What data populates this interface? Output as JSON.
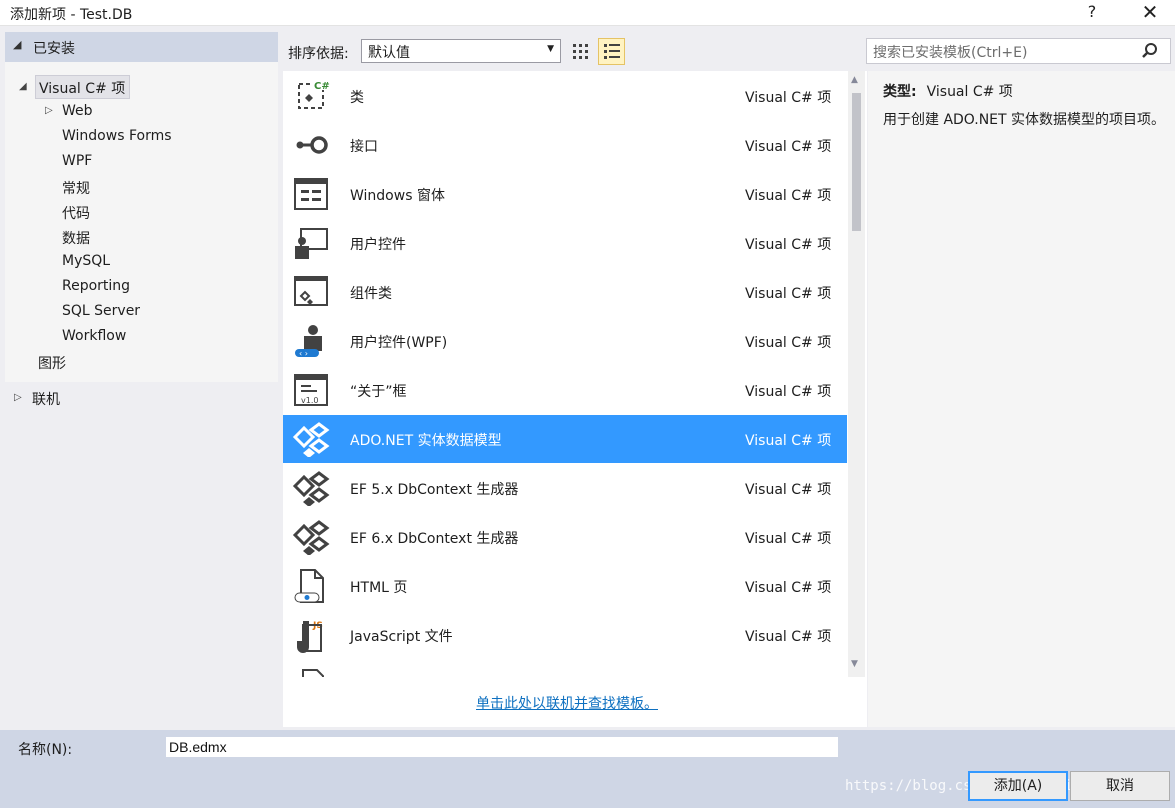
{
  "window": {
    "title": "添加新项 - Test.DB",
    "help": "?",
    "close": "✕"
  },
  "left": {
    "installed_label": "已安装",
    "root_label": "Visual C# 项",
    "children": [
      "Web",
      "Windows Forms",
      "WPF",
      "常规",
      "代码",
      "数据",
      "MySQL",
      "Reporting",
      "SQL Server",
      "Workflow"
    ],
    "graphics_label": "图形",
    "online_label": "联机"
  },
  "toolbar": {
    "sort_label": "排序依据:",
    "sort_value": "默认值",
    "search_placeholder": "搜索已安装模板(Ctrl+E)"
  },
  "items": [
    {
      "name": "类",
      "category": "Visual C# 项",
      "icon": "class-icon"
    },
    {
      "name": "接口",
      "category": "Visual C# 项",
      "icon": "interface-icon"
    },
    {
      "name": "Windows 窗体",
      "category": "Visual C# 项",
      "icon": "windows-form-icon"
    },
    {
      "name": "用户控件",
      "category": "Visual C# 项",
      "icon": "user-control-icon"
    },
    {
      "name": "组件类",
      "category": "Visual C# 项",
      "icon": "component-class-icon"
    },
    {
      "name": "用户控件(WPF)",
      "category": "Visual C# 项",
      "icon": "wpf-user-control-icon"
    },
    {
      "name": "“关于”框",
      "category": "Visual C# 项",
      "icon": "about-box-icon"
    },
    {
      "name": "ADO.NET 实体数据模型",
      "category": "Visual C# 项",
      "icon": "entity-model-icon",
      "selected": true
    },
    {
      "name": "EF 5.x DbContext 生成器",
      "category": "Visual C# 项",
      "icon": "entity-model-icon"
    },
    {
      "name": "EF 6.x DbContext 生成器",
      "category": "Visual C# 项",
      "icon": "entity-model-icon"
    },
    {
      "name": "HTML 页",
      "category": "Visual C# 项",
      "icon": "html-page-icon"
    },
    {
      "name": "JavaScript 文件",
      "category": "Visual C# 项",
      "icon": "javascript-file-icon"
    }
  ],
  "online_link": "单击此处以联机并查找模板。",
  "details": {
    "type_label": "类型:",
    "type_value": "Visual C# 项",
    "description": "用于创建 ADO.NET 实体数据模型的项目项。"
  },
  "bottom": {
    "name_label": "名称(N):",
    "name_value": "DB.edmx",
    "add_label": "添加(A)",
    "cancel_label": "取消",
    "watermark": "https://blog.csdn.net/shuai_liu"
  }
}
